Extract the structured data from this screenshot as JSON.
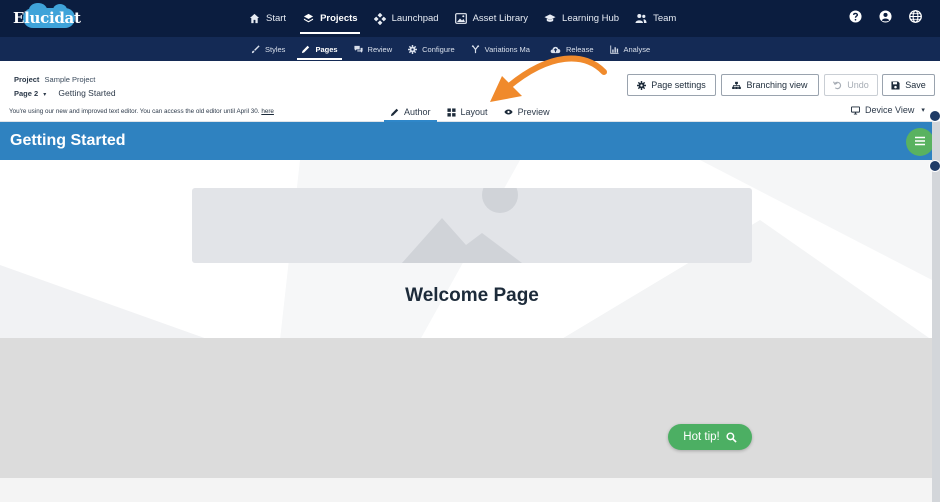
{
  "brand": {
    "logo_text": "Elucidat"
  },
  "top_nav": {
    "items": [
      {
        "label": "Start",
        "icon": "home-icon"
      },
      {
        "label": "Projects",
        "icon": "layers-icon",
        "active": true
      },
      {
        "label": "Launchpad",
        "icon": "launchpad-icon"
      },
      {
        "label": "Asset Library",
        "icon": "image-icon"
      },
      {
        "label": "Learning Hub",
        "icon": "graduation-cap-icon"
      },
      {
        "label": "Team",
        "icon": "team-icon"
      }
    ],
    "right_icons": [
      "help-icon",
      "user-icon",
      "globe-icon"
    ]
  },
  "sub_nav": {
    "items": [
      {
        "label": "Styles",
        "icon": "brush-icon"
      },
      {
        "label": "Pages",
        "icon": "pencil-icon",
        "active": true
      },
      {
        "label": "Review",
        "icon": "comments-icon"
      },
      {
        "label": "Configure",
        "icon": "gear-icon"
      },
      {
        "label": "Variations Ma",
        "icon": "variations-icon"
      },
      {
        "label": "Release",
        "icon": "cloud-upload-icon"
      },
      {
        "label": "Analyse",
        "icon": "bar-chart-icon"
      }
    ]
  },
  "toolbar": {
    "project_label": "Project",
    "project_name": "Sample Project",
    "page_label": "Page 2",
    "page_name": "Getting Started",
    "notice_text": "You're using our new and improved text editor. You can access the old editor until April 30.",
    "notice_link": "here",
    "tabs": [
      {
        "label": "Author",
        "icon": "pencil-icon",
        "active": true
      },
      {
        "label": "Layout",
        "icon": "grid-icon"
      },
      {
        "label": "Preview",
        "icon": "eye-icon"
      }
    ],
    "buttons": {
      "page_settings": "Page settings",
      "branching_view": "Branching view",
      "undo": "Undo",
      "save": "Save"
    },
    "device_view": "Device View"
  },
  "canvas": {
    "header_title": "Getting Started",
    "welcome_title": "Welcome Page",
    "hot_tip": "Hot tip!"
  },
  "colors": {
    "topbar": "#0b1d3f",
    "subbar": "#142a55",
    "header_blue": "#2f82c0",
    "accent_green": "#4caf63",
    "annotation_arrow": "#f08a2c"
  }
}
